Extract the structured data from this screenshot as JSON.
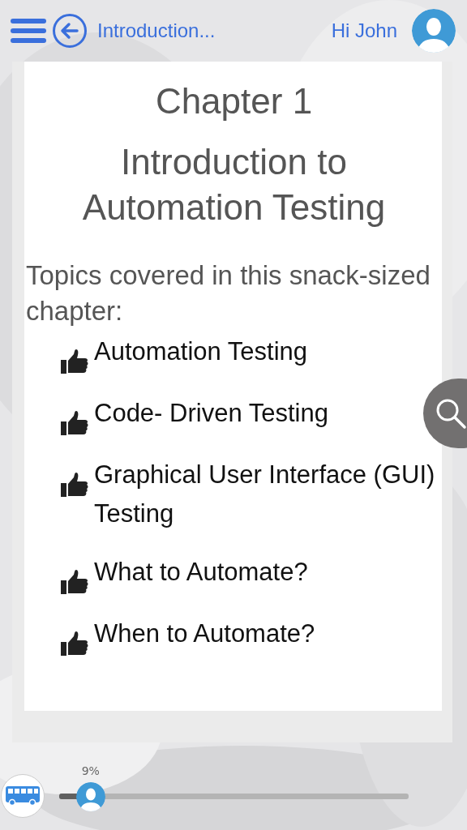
{
  "header": {
    "title": "Introduction...",
    "greeting": "Hi John"
  },
  "chapter": {
    "number": "Chapter 1",
    "title": "Introduction to Automation Testing",
    "intro": "Topics covered in this snack-sized chapter:",
    "topics": [
      "Automation Testing",
      "Code- Driven Testing",
      "Graphical User Interface (GUI) Testing",
      "What to Automate?",
      "When to Automate?"
    ]
  },
  "progress": {
    "reading": "9%",
    "level": 0.09
  }
}
